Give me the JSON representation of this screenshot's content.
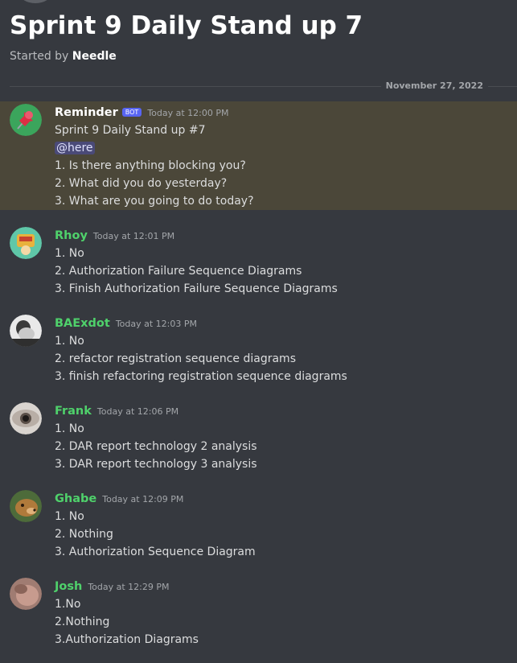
{
  "thread": {
    "title": "Sprint 9 Daily Stand up 7",
    "started_by_prefix": "Started by",
    "started_by_user": "Needle",
    "date_divider": "November 27, 2022"
  },
  "messages": [
    {
      "author": "Reminder",
      "badge": "BOT",
      "time": "Today at 12:00 PM",
      "title_line": "Sprint 9 Daily Stand up #7",
      "mention": "@here",
      "lines": [
        "1. Is there anything blocking you?",
        "2. What did you do yesterday?",
        "3. What are you going to do today?"
      ]
    },
    {
      "author": "Rhoy",
      "time": "Today at 12:01 PM",
      "lines": [
        "1. No",
        "2. Authorization Failure Sequence Diagrams",
        "3. Finish Authorization Failure Sequence Diagrams"
      ]
    },
    {
      "author": "BAExdot",
      "time": "Today at 12:03 PM",
      "lines": [
        "1. No",
        "2. refactor registration sequence diagrams",
        "3. finish refactoring registration sequence diagrams"
      ]
    },
    {
      "author": "Frank",
      "time": "Today at 12:06 PM",
      "lines": [
        "1. No",
        "2. DAR report technology 2 analysis",
        "3. DAR report technology 3 analysis"
      ]
    },
    {
      "author": "Ghabe",
      "time": "Today at 12:09 PM",
      "lines": [
        "1. No",
        "2. Nothing",
        "3. Authorization Sequence Diagram"
      ]
    },
    {
      "author": "Josh",
      "time": "Today at 12:29 PM",
      "lines": [
        "1.No",
        "2.Nothing",
        "3.Authorization Diagrams"
      ]
    }
  ],
  "colors": {
    "background": "#36393f",
    "highlight": "#4b4739",
    "author_green": "#4fd16b",
    "bot_badge": "#5865f2"
  },
  "icons": [
    "pushpin-avatar",
    "user-avatar"
  ]
}
